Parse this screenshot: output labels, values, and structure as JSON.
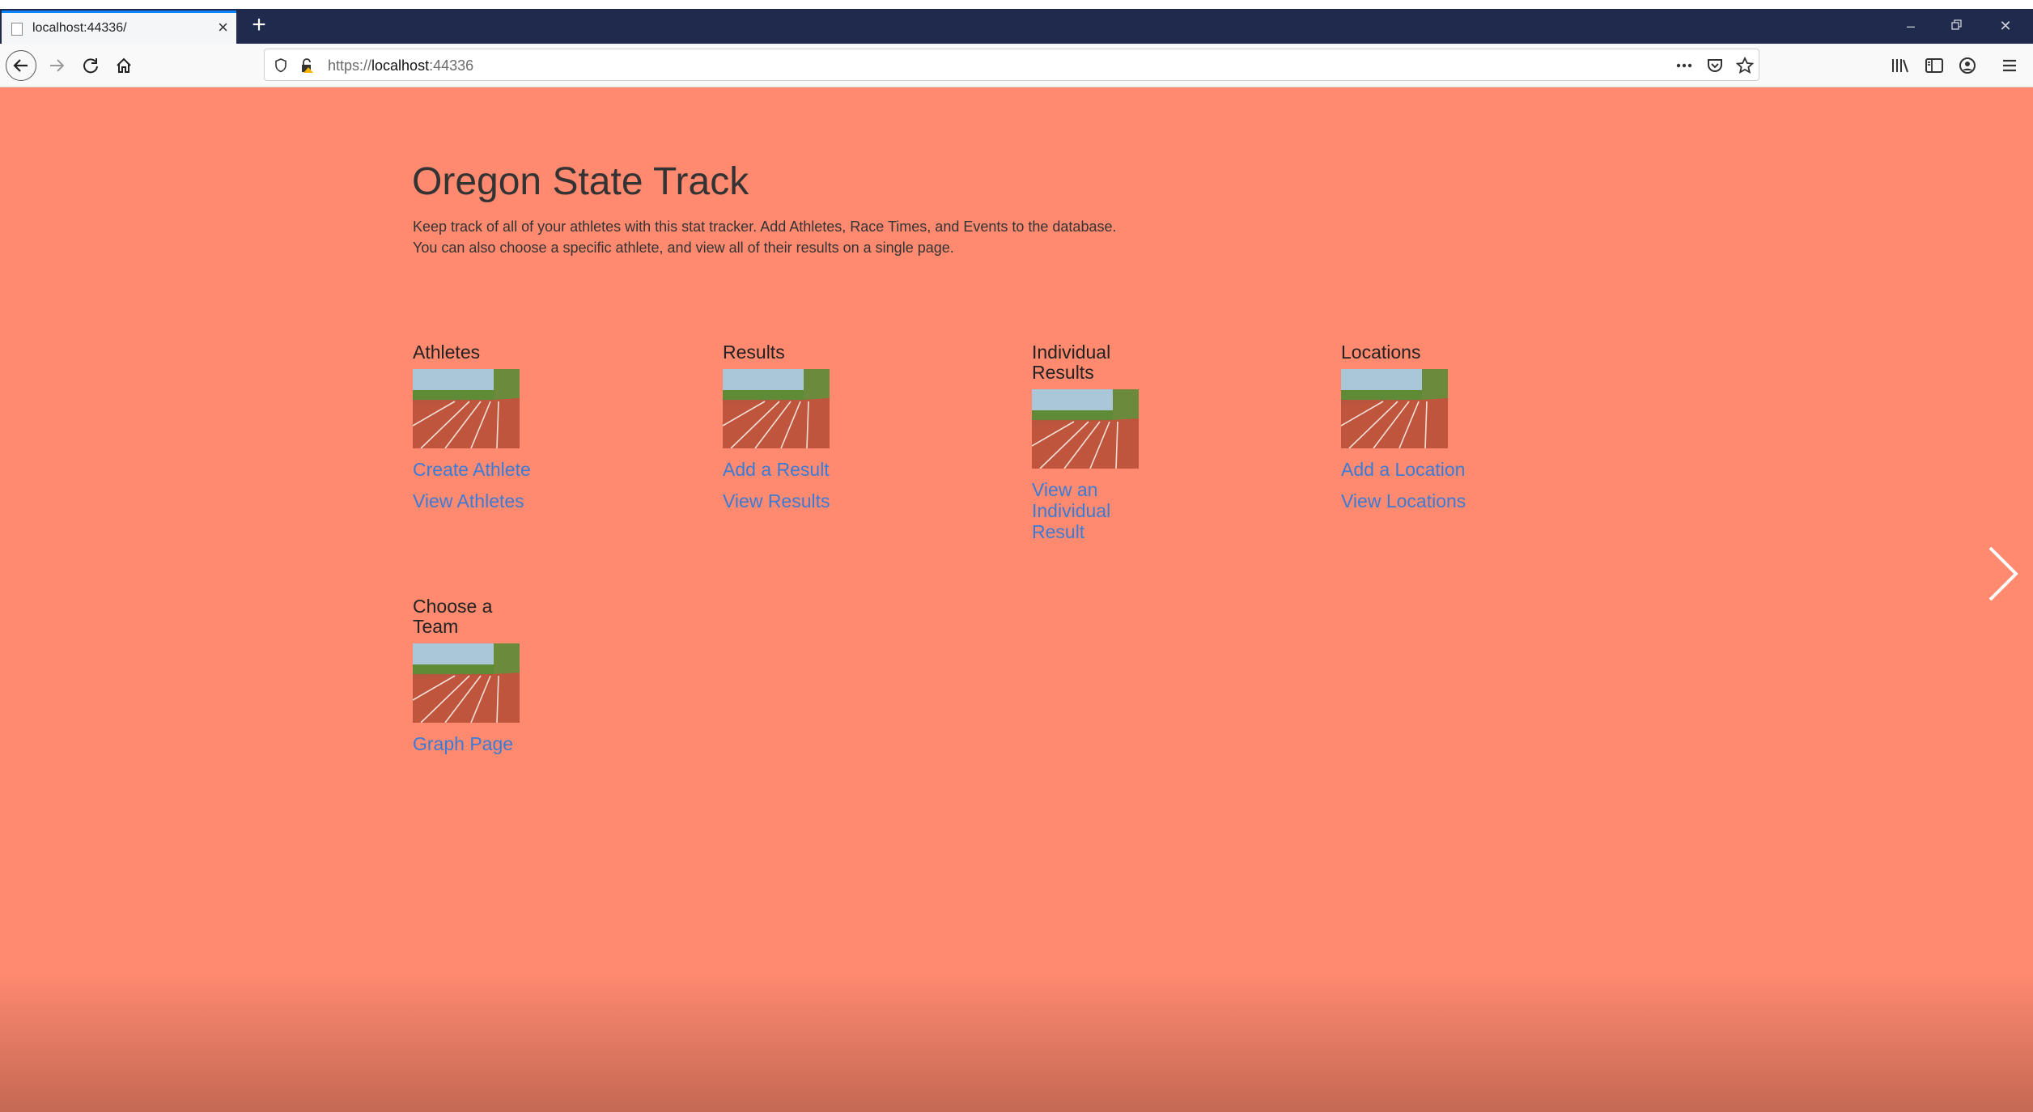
{
  "browser": {
    "tab_title": "localhost:44336/",
    "url_prefix": "https://",
    "url_host": "localhost",
    "url_port": ":44336",
    "icons": [
      "favicon-icon",
      "close-icon",
      "plus-icon",
      "minimize-icon",
      "restore-icon",
      "window-close-icon",
      "back-icon",
      "forward-icon",
      "reload-icon",
      "home-icon",
      "shield-icon",
      "lock-icon",
      "more-icon",
      "pocket-icon",
      "bookmark-star-icon",
      "library-icon",
      "sidebar-icon",
      "account-icon",
      "menu-icon"
    ]
  },
  "page": {
    "title": "Oregon State Track",
    "desc_line1": "Keep track of all of your athletes with this stat tracker. Add Athletes, Race Times, and Events to the database.",
    "desc_line2": "You can also choose a specific athlete, and view all of their results on a single page."
  },
  "cards": {
    "athletes": {
      "heading": "Athletes",
      "link1": "Create Athlete",
      "link2": "View Athletes"
    },
    "results": {
      "heading": "Results",
      "link1": "Add a Result",
      "link2": "View Results"
    },
    "individual": {
      "heading": "Individual Results",
      "link1": "View an Individual Result"
    },
    "locations": {
      "heading": "Locations",
      "link1": "Add a Location",
      "link2": "View Locations"
    },
    "team": {
      "heading": "Choose a Team",
      "link1": "Graph Page"
    }
  },
  "colors": {
    "page_background": "#ff8a70",
    "link": "#3a7bd5",
    "tabbar": "#1f2a4d"
  }
}
